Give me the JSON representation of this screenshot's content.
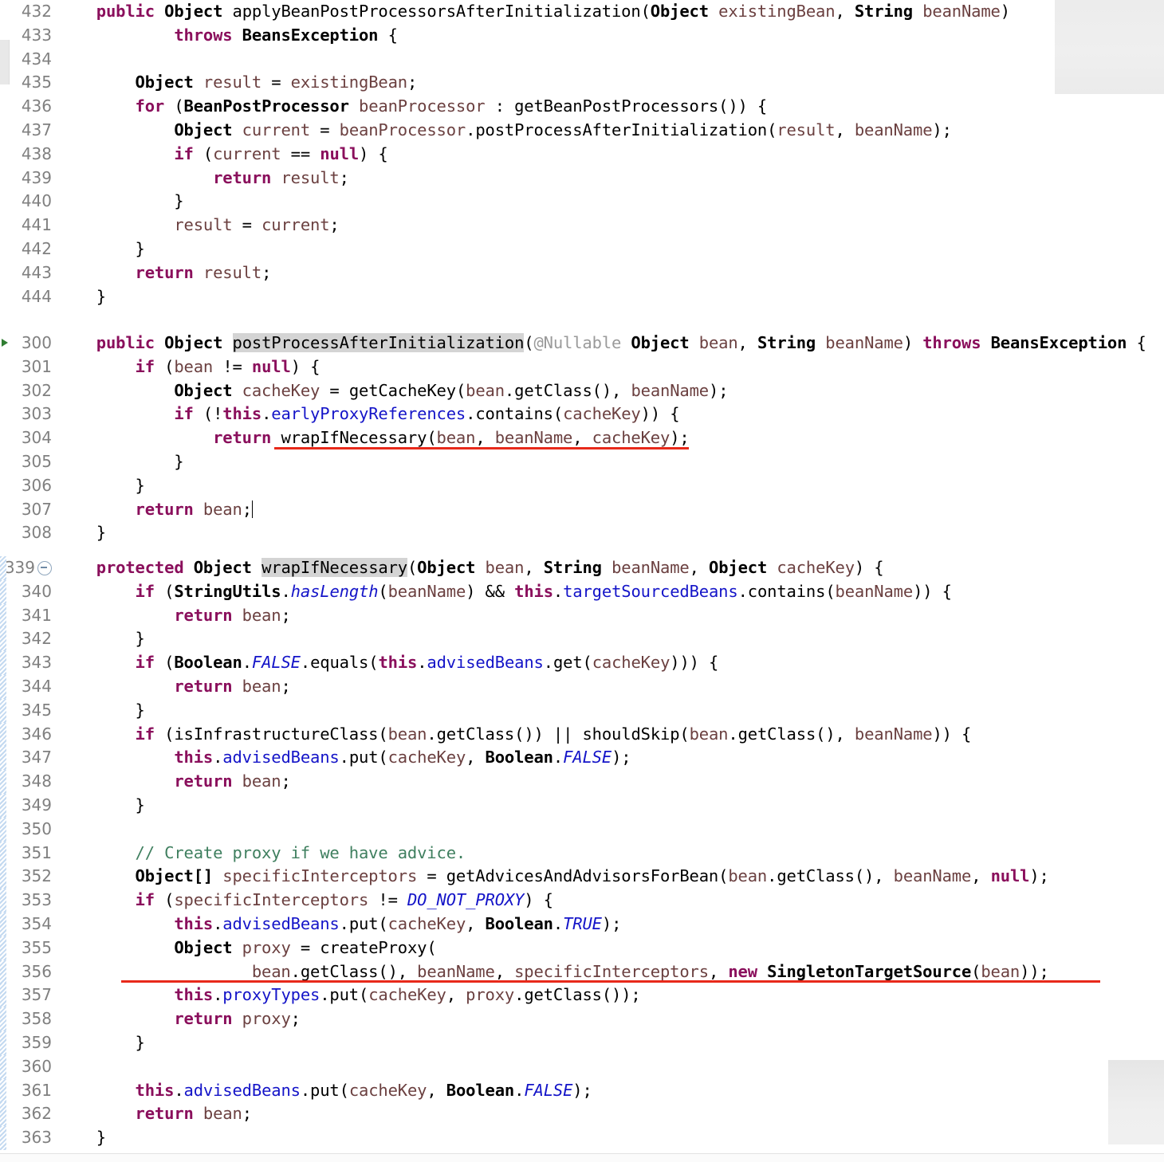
{
  "editor": {
    "language": "java",
    "font_size_px": 20,
    "line_height_px": 30,
    "colors": {
      "background": "#ffffff",
      "line_number": "#808080",
      "keyword": "#8a0f5c",
      "field": "#1414c8",
      "parameter": "#6b4040",
      "comment": "#3f7f5f",
      "occurrence_highlight": "#d4d4d4",
      "error_underline": "#e8291a",
      "panel_grey": "#ececec",
      "changed_bar": "#c3d9f0"
    }
  },
  "blocks": [
    {
      "id": "apply-bean-post-processors",
      "lines": [
        {
          "n": "432",
          "marked": false,
          "fold": false,
          "run": false
        },
        {
          "n": "433",
          "marked": false,
          "fold": false,
          "run": false
        },
        {
          "n": "434",
          "marked": false,
          "fold": false,
          "run": false
        },
        {
          "n": "435",
          "marked": false,
          "fold": false,
          "run": false
        },
        {
          "n": "436",
          "marked": false,
          "fold": false,
          "run": false
        },
        {
          "n": "437",
          "marked": false,
          "fold": false,
          "run": false
        },
        {
          "n": "438",
          "marked": false,
          "fold": false,
          "run": false
        },
        {
          "n": "439",
          "marked": false,
          "fold": false,
          "run": false
        },
        {
          "n": "440",
          "marked": false,
          "fold": false,
          "run": false
        },
        {
          "n": "441",
          "marked": false,
          "fold": false,
          "run": false
        },
        {
          "n": "442",
          "marked": false,
          "fold": false,
          "run": false
        },
        {
          "n": "443",
          "marked": false,
          "fold": false,
          "run": false
        },
        {
          "n": "444",
          "marked": false,
          "fold": false,
          "run": false
        }
      ],
      "text": [
        "    public Object applyBeanPostProcessorsAfterInitialization(Object existingBean, String beanName)",
        "            throws BeansException {",
        "",
        "        Object result = existingBean;",
        "        for (BeanPostProcessor beanProcessor : getBeanPostProcessors()) {",
        "            Object current = beanProcessor.postProcessAfterInitialization(result, beanName);",
        "            if (current == null) {",
        "                return result;",
        "            }",
        "            result = current;",
        "        }",
        "        return result;",
        "    }"
      ]
    },
    {
      "id": "post-process-after-initialization",
      "lines": [
        {
          "n": "300",
          "marked": false,
          "fold": false,
          "run": true
        },
        {
          "n": "301",
          "marked": false,
          "fold": false,
          "run": false
        },
        {
          "n": "302",
          "marked": false,
          "fold": false,
          "run": false
        },
        {
          "n": "303",
          "marked": false,
          "fold": false,
          "run": false
        },
        {
          "n": "304",
          "marked": false,
          "fold": false,
          "run": false
        },
        {
          "n": "305",
          "marked": false,
          "fold": false,
          "run": false
        },
        {
          "n": "306",
          "marked": false,
          "fold": false,
          "run": false
        },
        {
          "n": "307",
          "marked": false,
          "fold": false,
          "run": false
        },
        {
          "n": "308",
          "marked": false,
          "fold": false,
          "run": false
        }
      ],
      "text": [
        "    public Object postProcessAfterInitialization(@Nullable Object bean, String beanName) throws BeansException {",
        "        if (bean != null) {",
        "            Object cacheKey = getCacheKey(bean.getClass(), beanName);",
        "            if (!this.earlyProxyReferences.contains(cacheKey)) {",
        "                return wrapIfNecessary(bean, beanName, cacheKey);",
        "            }",
        "        }",
        "        return bean;",
        "    }"
      ],
      "occurrence_highlight": "postProcessAfterInitialization",
      "error_underline_line": "304"
    },
    {
      "id": "wrap-if-necessary",
      "lines": [
        {
          "n": "339",
          "marked": true,
          "fold": true,
          "run": false
        },
        {
          "n": "340",
          "marked": true,
          "fold": false,
          "run": false
        },
        {
          "n": "341",
          "marked": true,
          "fold": false,
          "run": false
        },
        {
          "n": "342",
          "marked": true,
          "fold": false,
          "run": false
        },
        {
          "n": "343",
          "marked": true,
          "fold": false,
          "run": false
        },
        {
          "n": "344",
          "marked": true,
          "fold": false,
          "run": false
        },
        {
          "n": "345",
          "marked": true,
          "fold": false,
          "run": false
        },
        {
          "n": "346",
          "marked": true,
          "fold": false,
          "run": false
        },
        {
          "n": "347",
          "marked": true,
          "fold": false,
          "run": false
        },
        {
          "n": "348",
          "marked": true,
          "fold": false,
          "run": false
        },
        {
          "n": "349",
          "marked": true,
          "fold": false,
          "run": false
        },
        {
          "n": "350",
          "marked": true,
          "fold": false,
          "run": false
        },
        {
          "n": "351",
          "marked": true,
          "fold": false,
          "run": false
        },
        {
          "n": "352",
          "marked": true,
          "fold": false,
          "run": false
        },
        {
          "n": "353",
          "marked": true,
          "fold": false,
          "run": false
        },
        {
          "n": "354",
          "marked": true,
          "fold": false,
          "run": false
        },
        {
          "n": "355",
          "marked": true,
          "fold": false,
          "run": false
        },
        {
          "n": "356",
          "marked": true,
          "fold": false,
          "run": false
        },
        {
          "n": "357",
          "marked": true,
          "fold": false,
          "run": false
        },
        {
          "n": "358",
          "marked": true,
          "fold": false,
          "run": false
        },
        {
          "n": "359",
          "marked": true,
          "fold": false,
          "run": false
        },
        {
          "n": "360",
          "marked": true,
          "fold": false,
          "run": false
        },
        {
          "n": "361",
          "marked": true,
          "fold": false,
          "run": false
        },
        {
          "n": "362",
          "marked": true,
          "fold": false,
          "run": false
        },
        {
          "n": "363",
          "marked": true,
          "fold": false,
          "run": false
        }
      ],
      "text": [
        "    protected Object wrapIfNecessary(Object bean, String beanName, Object cacheKey) {",
        "        if (StringUtils.hasLength(beanName) && this.targetSourcedBeans.contains(beanName)) {",
        "            return bean;",
        "        }",
        "        if (Boolean.FALSE.equals(this.advisedBeans.get(cacheKey))) {",
        "            return bean;",
        "        }",
        "        if (isInfrastructureClass(bean.getClass()) || shouldSkip(bean.getClass(), beanName)) {",
        "            this.advisedBeans.put(cacheKey, Boolean.FALSE);",
        "            return bean;",
        "        }",
        "",
        "        // Create proxy if we have advice.",
        "        Object[] specificInterceptors = getAdvicesAndAdvisorsForBean(bean.getClass(), beanName, null);",
        "        if (specificInterceptors != DO_NOT_PROXY) {",
        "            this.advisedBeans.put(cacheKey, Boolean.TRUE);",
        "            Object proxy = createProxy(",
        "                    bean.getClass(), beanName, specificInterceptors, new SingletonTargetSource(bean));",
        "            this.proxyTypes.put(cacheKey, proxy.getClass());",
        "            return proxy;",
        "        }",
        "",
        "        this.advisedBeans.put(cacheKey, Boolean.FALSE);",
        "        return bean;",
        "    }"
      ],
      "occurrence_highlight": "wrapIfNecessary",
      "error_underline_line": "356"
    }
  ]
}
